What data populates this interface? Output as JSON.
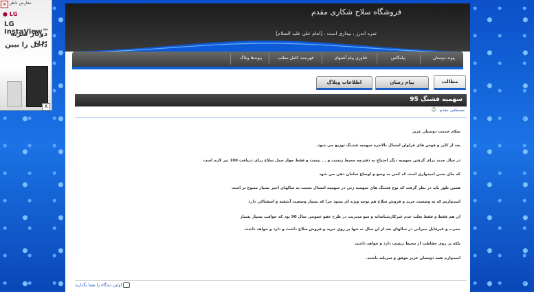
{
  "ad": {
    "close_label": "✕",
    "top_label": "معارض ناظر",
    "brand": "● LG",
    "product": "LG InstaView™",
    "line1": "دوبار ضربه بزن",
    "line2": "داخل را ببین",
    "close_box": "X"
  },
  "header": {
    "title": "فروشگاه سلاح شکاری مقدم",
    "slogan": "ثمره اندرز ، بیداری است . [امام علی علیه السلام]"
  },
  "nav": {
    "items": [
      "پیوند دوستان",
      "پیامگاس",
      "فناوری پیام آشنهای",
      "فهرست کامل مطلب",
      "پیوندها وبلاگ"
    ]
  },
  "tabs": [
    {
      "label": "مطالب"
    },
    {
      "label": "پیام رسان"
    },
    {
      "label": "اطلاعات وبلاگ"
    }
  ],
  "post": {
    "title": "سهمیه فشنگ 95",
    "author": "مصطفی مقدم",
    "lines": [
      "سلام خدمت دوستان عزیز",
      "بعد از کلی و قوس های فراوان امسال بالاخره سهمیه فشنگ توزیع می شود.",
      "در سال جدید برای گرفتن سهمیه دیگر احتیاج به دفترچه محیط زیست و ... نیست و فقط جواز حمل سلاح برای دریافت 100 تیر لازم است",
      "که جای بسی امیدواری است که کمی به وضع و اوضاع سامان دهی می شود",
      "همین طور باید در نظر گرفت که نوع فشنگ های سهمیه زنی در سهمیه امسال نسبت به سالهای اخیر بسیار متنوع تر است",
      "امیدواریم که به وضعیت خرید و فروش سلاح هم توجه ویژه ای بشود چرا که بسیار وضعیت آشفته و اسفناکی دارد",
      "ان هم فقط و فقط بعلت عدم غیرکارشناسانه و سو مدیریت در طرح عفو عمومی سال 90 بود که عواقب بسیار بسیار",
      "مخرب و غیرقابل جبرانی در سالهای بعد از ان سال نه تنها بر روی خرید و فروش سلاح داشت و دارد و خواهد داشت",
      "بلکه بر روی حفاظت از محیط زیست دارد و خواهد داشت",
      "امیدوارم همه دوستان عزیز موفق و سربلند باشند."
    ],
    "footer_link": "اولین دیدگاه را شما بگذارید"
  }
}
